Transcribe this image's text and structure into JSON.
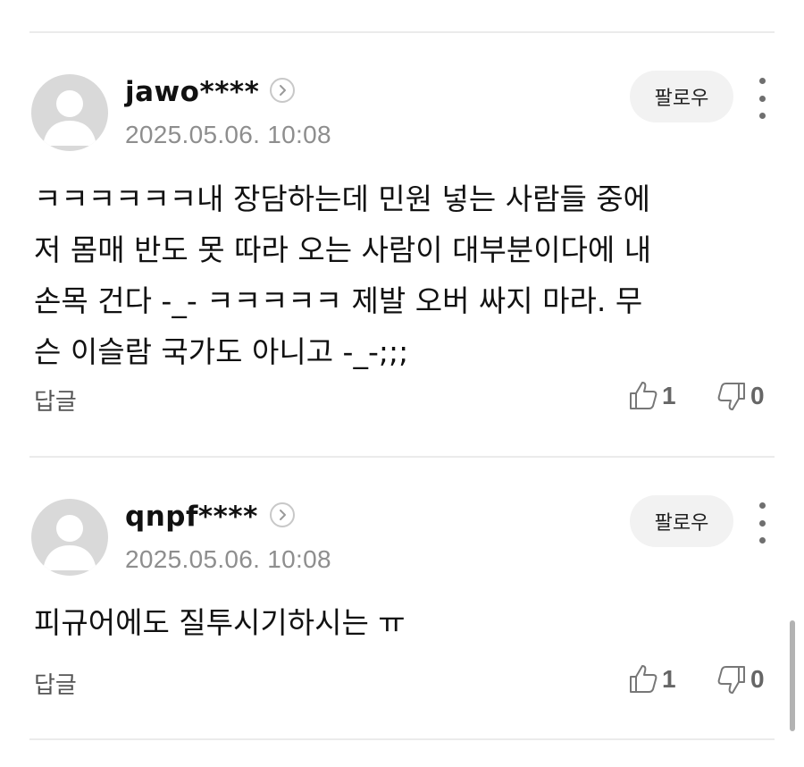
{
  "comments": [
    {
      "username": "jawo****",
      "timestamp": "2025.05.06. 10:08",
      "follow_label": "팔로우",
      "body": "ㅋㅋㅋㅋㅋㅋ내 장담하는데 민원 넣는 사람들 중에\n저 몸매 반도 못 따라 오는 사람이 대부분이다에 내\n손목 건다 -_- ㅋㅋㅋㅋㅋ 제발 오버 싸지 마라. 무\n슨 이슬람 국가도 아니고 -_-;;;",
      "reply_label": "답글",
      "likes": "1",
      "dislikes": "0"
    },
    {
      "username": "qnpf****",
      "timestamp": "2025.05.06. 10:08",
      "follow_label": "팔로우",
      "body": "피규어에도 질투시기하시는 ㅠ",
      "reply_label": "답글",
      "likes": "1",
      "dislikes": "0"
    }
  ],
  "icons": {
    "avatar": "default-avatar-icon",
    "profile_link": "chevron-right-icon",
    "more": "more-vertical-icon",
    "like": "thumbs-up-icon",
    "dislike": "thumbs-down-icon"
  },
  "colors": {
    "avatar_bg": "#d9d9d9",
    "follow_bg": "#f2f2f2",
    "timestamp": "#8e8e8e",
    "divider": "#ebebeb"
  }
}
